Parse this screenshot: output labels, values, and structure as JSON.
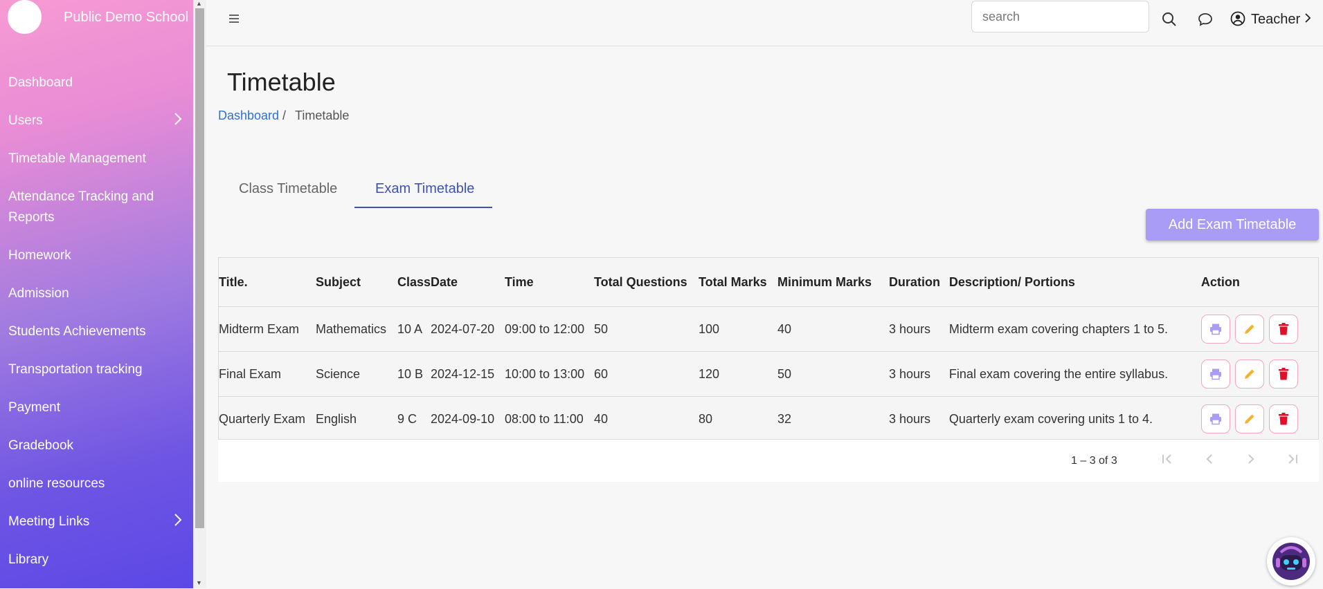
{
  "sidebar": {
    "school_name": "Public Demo School",
    "items": [
      {
        "label": "Dashboard"
      },
      {
        "label": "Users"
      },
      {
        "label": "Timetable Management"
      },
      {
        "label": "Attendance Tracking and"
      },
      {
        "label": "Reports"
      },
      {
        "label": "Homework"
      },
      {
        "label": "Admission"
      },
      {
        "label": "Students Achievements"
      },
      {
        "label": "Transportation tracking"
      },
      {
        "label": "Payment"
      },
      {
        "label": "Gradebook"
      },
      {
        "label": "online resources"
      },
      {
        "label": "Meeting Links"
      },
      {
        "label": "Library"
      }
    ]
  },
  "header": {
    "search_placeholder": "search",
    "user_label": "Teacher"
  },
  "page": {
    "title": "Timetable",
    "breadcrumb": {
      "link": "Dashboard",
      "separator": "/",
      "current": "Timetable"
    }
  },
  "tabs": [
    {
      "label": "Class Timetable",
      "active": false
    },
    {
      "label": "Exam Timetable",
      "active": true
    }
  ],
  "add_button": "Add Exam Timetable",
  "table": {
    "columns": [
      "Title.",
      "Subject",
      "Class",
      "Date",
      "Time",
      "Total Questions",
      "Total Marks",
      "Minimum Marks",
      "Duration",
      "Description/ Portions",
      "Action"
    ],
    "rows": [
      [
        "Midterm Exam",
        "Mathematics",
        "10 A",
        "2024-07-20",
        "09:00 to 12:00",
        "50",
        "100",
        "40",
        "3 hours",
        "Midterm exam covering chapters 1 to 5."
      ],
      [
        "Final Exam",
        "Science",
        "10 B",
        "2024-12-15",
        "10:00 to 13:00",
        "60",
        "120",
        "50",
        "3 hours",
        "Final exam covering the entire syllabus."
      ],
      [
        "Quarterly Exam",
        "English",
        "9 C",
        "2024-09-10",
        "08:00 to 11:00",
        "40",
        "80",
        "32",
        "3 hours",
        "Quarterly exam covering units 1 to 4."
      ]
    ]
  },
  "pagination": {
    "range": "1 – 3 of 3"
  },
  "colors": {
    "accent": "#3f51b5",
    "add_button": "#a99cf6",
    "print": "#a99cf6",
    "edit": "#f5b22c",
    "delete": "#e0102b"
  }
}
